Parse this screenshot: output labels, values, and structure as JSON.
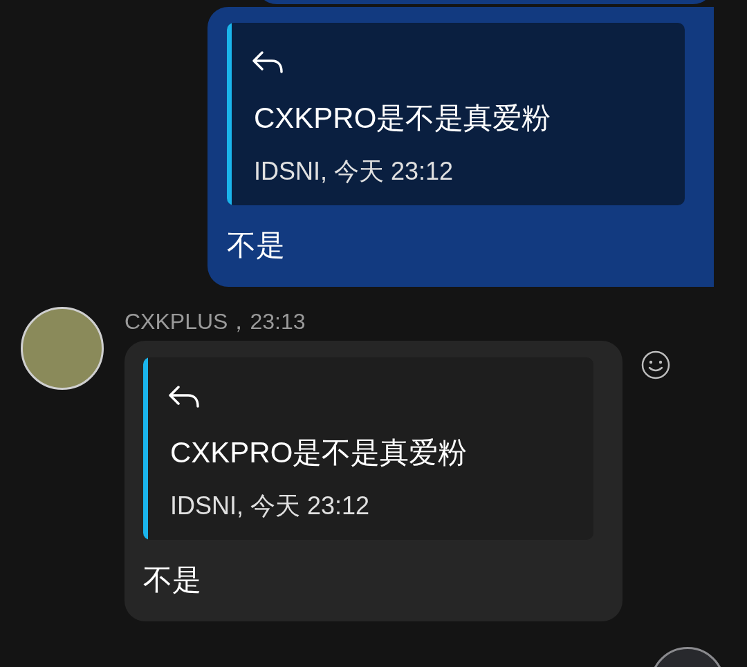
{
  "messages": [
    {
      "kind": "outgoing",
      "quote": {
        "text": "CXKPRO是不是真爱粉",
        "meta": "IDSNI, 今天 23:12"
      },
      "text": "不是"
    },
    {
      "kind": "incoming",
      "sender": "CXKPLUS，23:13",
      "quote": {
        "text": "CXKPRO是不是真爱粉",
        "meta": "IDSNI, 今天 23:12"
      },
      "text": "不是"
    }
  ]
}
